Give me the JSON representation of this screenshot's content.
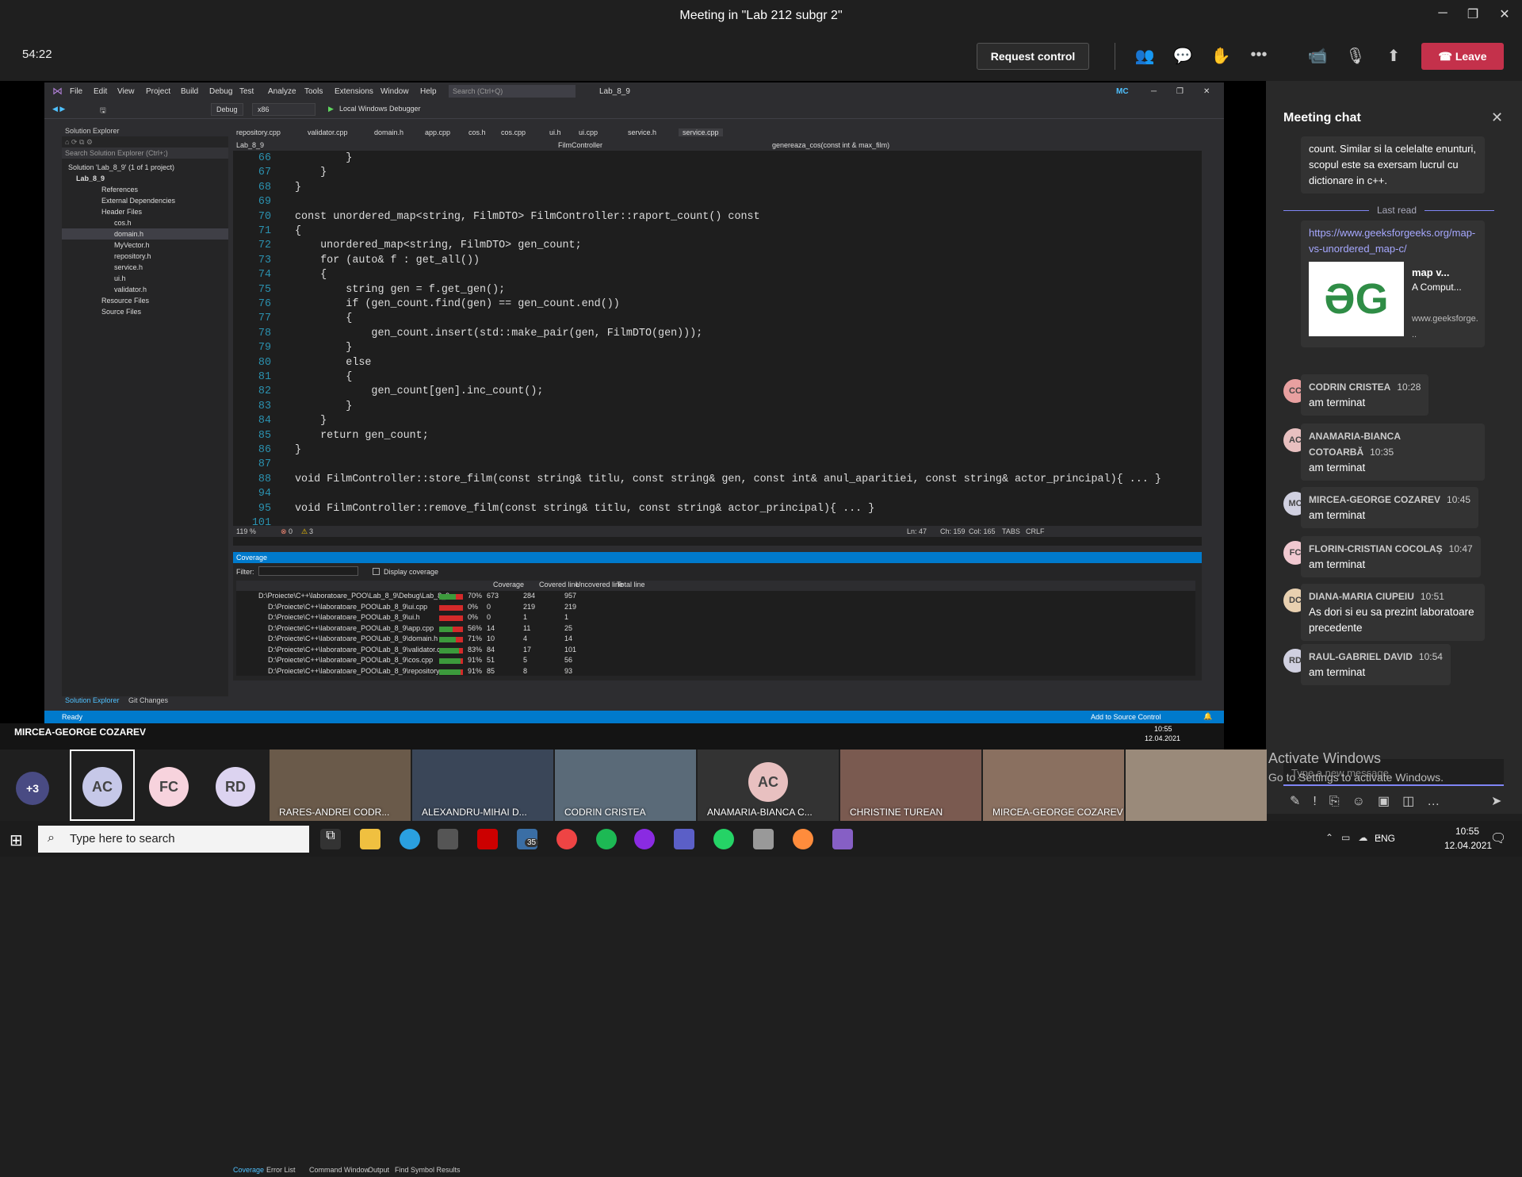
{
  "window": {
    "title": "Meeting in \"Lab 212 subgr 2\""
  },
  "meeting": {
    "timer": "54:22",
    "request_control": "Request control",
    "leave": "Leave"
  },
  "vs": {
    "menu": [
      "File",
      "Edit",
      "View",
      "Project",
      "Build",
      "Debug",
      "Test",
      "Analyze",
      "Tools",
      "Extensions",
      "Window",
      "Help"
    ],
    "search_placeholder": "Search (Ctrl+Q)",
    "solution_name": "Lab_8_9",
    "user_badge": "MC",
    "config": "Debug",
    "platform": "x86",
    "debugger": "Local Windows Debugger",
    "solution_explorer": {
      "title": "Solution Explorer",
      "search": "Search Solution Explorer (Ctrl+;)",
      "rows": [
        "Solution 'Lab_8_9' (1 of 1 project)",
        "Lab_8_9",
        "References",
        "External Dependencies",
        "Header Files",
        "cos.h",
        "domain.h",
        "MyVector.h",
        "repository.h",
        "service.h",
        "ui.h",
        "validator.h",
        "Resource Files",
        "Source Files"
      ]
    },
    "tabs": [
      "repository.cpp",
      "validator.cpp",
      "domain.h",
      "app.cpp",
      "cos.h",
      "cos.cpp",
      "ui.h",
      "ui.cpp",
      "service.h",
      "service.cpp"
    ],
    "active_tab": "service.cpp",
    "nav": {
      "project": "Lab_8_9",
      "class": "FilmController",
      "member": "genereaza_cos(const int & max_film)"
    },
    "code_lines": [
      {
        "n": "66",
        "t": "        }"
      },
      {
        "n": "67",
        "t": "    }"
      },
      {
        "n": "68",
        "t": "}"
      },
      {
        "n": "69",
        "t": ""
      },
      {
        "n": "70",
        "t": "const unordered_map<string, FilmDTO> FilmController::raport_count() const"
      },
      {
        "n": "71",
        "t": "{"
      },
      {
        "n": "72",
        "t": "    unordered_map<string, FilmDTO> gen_count;"
      },
      {
        "n": "73",
        "t": "    for (auto& f : get_all())"
      },
      {
        "n": "74",
        "t": "    {"
      },
      {
        "n": "75",
        "t": "        string gen = f.get_gen();"
      },
      {
        "n": "76",
        "t": "        if (gen_count.find(gen) == gen_count.end())"
      },
      {
        "n": "77",
        "t": "        {"
      },
      {
        "n": "78",
        "t": "            gen_count.insert(std::make_pair(gen, FilmDTO(gen)));"
      },
      {
        "n": "79",
        "t": "        }"
      },
      {
        "n": "80",
        "t": "        else"
      },
      {
        "n": "81",
        "t": "        {"
      },
      {
        "n": "82",
        "t": "            gen_count[gen].inc_count();"
      },
      {
        "n": "83",
        "t": "        }"
      },
      {
        "n": "84",
        "t": "    }"
      },
      {
        "n": "85",
        "t": "    return gen_count;"
      },
      {
        "n": "86",
        "t": "}"
      },
      {
        "n": "87",
        "t": ""
      },
      {
        "n": "88",
        "t": "void FilmController::store_film(const string& titlu, const string& gen, const int& anul_aparitiei, const string& actor_principal){ ... }"
      },
      {
        "n": "94",
        "t": ""
      },
      {
        "n": "95",
        "t": "void FilmController::remove_film(const string& titlu, const string& actor_principal){ ... }"
      },
      {
        "n": "101",
        "t": ""
      }
    ],
    "status": {
      "zoom": "119 %",
      "errors": "0",
      "warnings": "3",
      "ln": "Ln: 47",
      "ch": "Ch: 159",
      "col": "Col: 165",
      "tabs": "TABS",
      "crlf": "CRLF",
      "ready": "Ready",
      "source_control": "Add to Source Control"
    },
    "coverage": {
      "title": "Coverage",
      "filter_label": "Filter:",
      "display_coverage": "Display coverage",
      "headers": [
        "Coverage",
        "Covered line",
        "Uncovered line",
        "Total line"
      ],
      "rows": [
        {
          "path": "D:\\Proiecte\\C++\\laboratoare_POO\\Lab_8_9\\Debug\\Lab_8_9.exe",
          "pct": "70%",
          "cov": "673",
          "unc": "284",
          "tot": "957",
          "frac": 0.7
        },
        {
          "path": "D:\\Proiecte\\C++\\laboratoare_POO\\Lab_8_9\\ui.cpp",
          "pct": "0%",
          "cov": "0",
          "unc": "219",
          "tot": "219",
          "frac": 0
        },
        {
          "path": "D:\\Proiecte\\C++\\laboratoare_POO\\Lab_8_9\\ui.h",
          "pct": "0%",
          "cov": "0",
          "unc": "1",
          "tot": "1",
          "frac": 0
        },
        {
          "path": "D:\\Proiecte\\C++\\laboratoare_POO\\Lab_8_9\\app.cpp",
          "pct": "56%",
          "cov": "14",
          "unc": "11",
          "tot": "25",
          "frac": 0.56
        },
        {
          "path": "D:\\Proiecte\\C++\\laboratoare_POO\\Lab_8_9\\domain.h",
          "pct": "71%",
          "cov": "10",
          "unc": "4",
          "tot": "14",
          "frac": 0.71
        },
        {
          "path": "D:\\Proiecte\\C++\\laboratoare_POO\\Lab_8_9\\validator.cpp",
          "pct": "83%",
          "cov": "84",
          "unc": "17",
          "tot": "101",
          "frac": 0.83
        },
        {
          "path": "D:\\Proiecte\\C++\\laboratoare_POO\\Lab_8_9\\cos.cpp",
          "pct": "91%",
          "cov": "51",
          "unc": "5",
          "tot": "56",
          "frac": 0.91
        },
        {
          "path": "D:\\Proiecte\\C++\\laboratoare_POO\\Lab_8_9\\repository.cpp",
          "pct": "91%",
          "cov": "85",
          "unc": "8",
          "tot": "93",
          "frac": 0.91
        }
      ]
    },
    "bottom_tabs_left": [
      "Solution Explorer",
      "Git Changes"
    ],
    "bottom_tabs": [
      "Coverage",
      "Error List",
      "Command Window",
      "Output",
      "Find Symbol Results"
    ]
  },
  "inner_taskbar": {
    "presenter": "MIRCEA-GEORGE COZAREV",
    "time": "10:55",
    "date": "12.04.2021"
  },
  "chat": {
    "title": "Meeting chat",
    "first_msg": "count. Similar si la celelalte enunturi, scopul este sa exersam lucrul cu dictionare in c++.",
    "last_read": "Last read",
    "link": "https://www.geeksforgeeks.org/map-vs-unordered_map-c/",
    "card": {
      "title": "map v...",
      "desc": "A Comput...",
      "site": "www.geeksforge..."
    },
    "messages": [
      {
        "init": "CC",
        "name": "CODRIN CRISTEA",
        "time": "10:28",
        "text": "am terminat",
        "color": "#e8a0a0"
      },
      {
        "init": "AC",
        "name": "ANAMARIA-BIANCA COTOARBĂ",
        "time": "10:35",
        "text": "am terminat",
        "color": "#e8c0c0"
      },
      {
        "init": "MC",
        "name": "MIRCEA-GEORGE COZAREV",
        "time": "10:45",
        "text": "am terminat",
        "color": "#d0d0e0"
      },
      {
        "init": "FC",
        "name": "FLORIN-CRISTIAN COCOLAȘ",
        "time": "10:47",
        "text": "am terminat",
        "color": "#f0c8d0"
      },
      {
        "init": "DC",
        "name": "DIANA-MARIA CIUPEIU",
        "time": "10:51",
        "text": "As dori si eu sa prezint laboratoare precedente",
        "color": "#e8d0b0"
      },
      {
        "init": "RD",
        "name": "RAUL-GABRIEL DAVID",
        "time": "10:54",
        "text": "am terminat",
        "color": "#d0d0e0"
      }
    ],
    "compose_placeholder": "Type a new message"
  },
  "gallery": {
    "more": "+3",
    "avatars": [
      "AC",
      "FC",
      "RD"
    ],
    "tiles": [
      "RARES-ANDREI CODR...",
      "ALEXANDRU-MIHAI D...",
      "CODRIN CRISTEA",
      "ANAMARIA-BIANCA C...",
      "CHRISTINE TUREAN",
      "MIRCEA-GEORGE COZAREV",
      ""
    ],
    "tile_avatar": "AC"
  },
  "watermark": {
    "line1": "Activate Windows",
    "line2": "Go to Settings to activate Windows."
  },
  "taskbar": {
    "search": "Type here to search",
    "badge": "35",
    "lang": "ENG",
    "time": "10:55",
    "date": "12.04.2021"
  }
}
